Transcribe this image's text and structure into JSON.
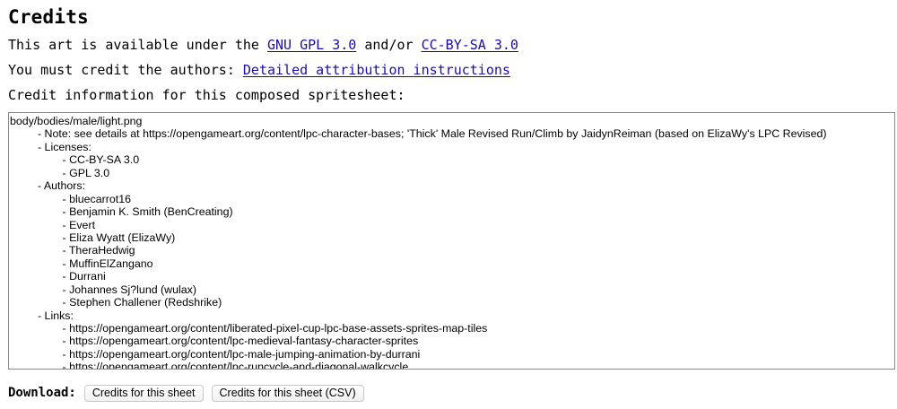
{
  "heading": "Credits",
  "license_line": {
    "prefix": "This art is available under the ",
    "gpl_link": "GNU GPL 3.0",
    "middle": " and/or ",
    "ccbysa_link": "CC-BY-SA 3.0"
  },
  "credit_line": {
    "prefix": "You must credit the authors: ",
    "attribution_link": "Detailed attribution instructions"
  },
  "info_line": "Credit information for this composed spritesheet:",
  "credits_text": [
    "body/bodies/male/light.png",
    "\t- Note: see details at https://opengameart.org/content/lpc-character-bases; 'Thick' Male Revised Run/Climb by JaidynReiman (based on ElizaWy's LPC Revised)",
    "\t- Licenses:",
    "\t\t- CC-BY-SA 3.0",
    "\t\t- GPL 3.0",
    "\t- Authors:",
    "\t\t- bluecarrot16",
    "\t\t- Benjamin K. Smith (BenCreating)",
    "\t\t- Evert",
    "\t\t- Eliza Wyatt (ElizaWy)",
    "\t\t- TheraHedwig",
    "\t\t- MuffinElZangano",
    "\t\t- Durrani",
    "\t\t- Johannes Sj?lund (wulax)",
    "\t\t- Stephen Challener (Redshrike)",
    "\t- Links:",
    "\t\t- https://opengameart.org/content/liberated-pixel-cup-lpc-base-assets-sprites-map-tiles",
    "\t\t- https://opengameart.org/content/lpc-medieval-fantasy-character-sprites",
    "\t\t- https://opengameart.org/content/lpc-male-jumping-animation-by-durrani",
    "\t\t- https://opengameart.org/content/lpc-runcycle-and-diagonal-walkcycle"
  ],
  "download": {
    "label": "Download:",
    "credits_button": "Credits for this sheet",
    "credits_csv_button": "Credits for this sheet (CSV)"
  }
}
